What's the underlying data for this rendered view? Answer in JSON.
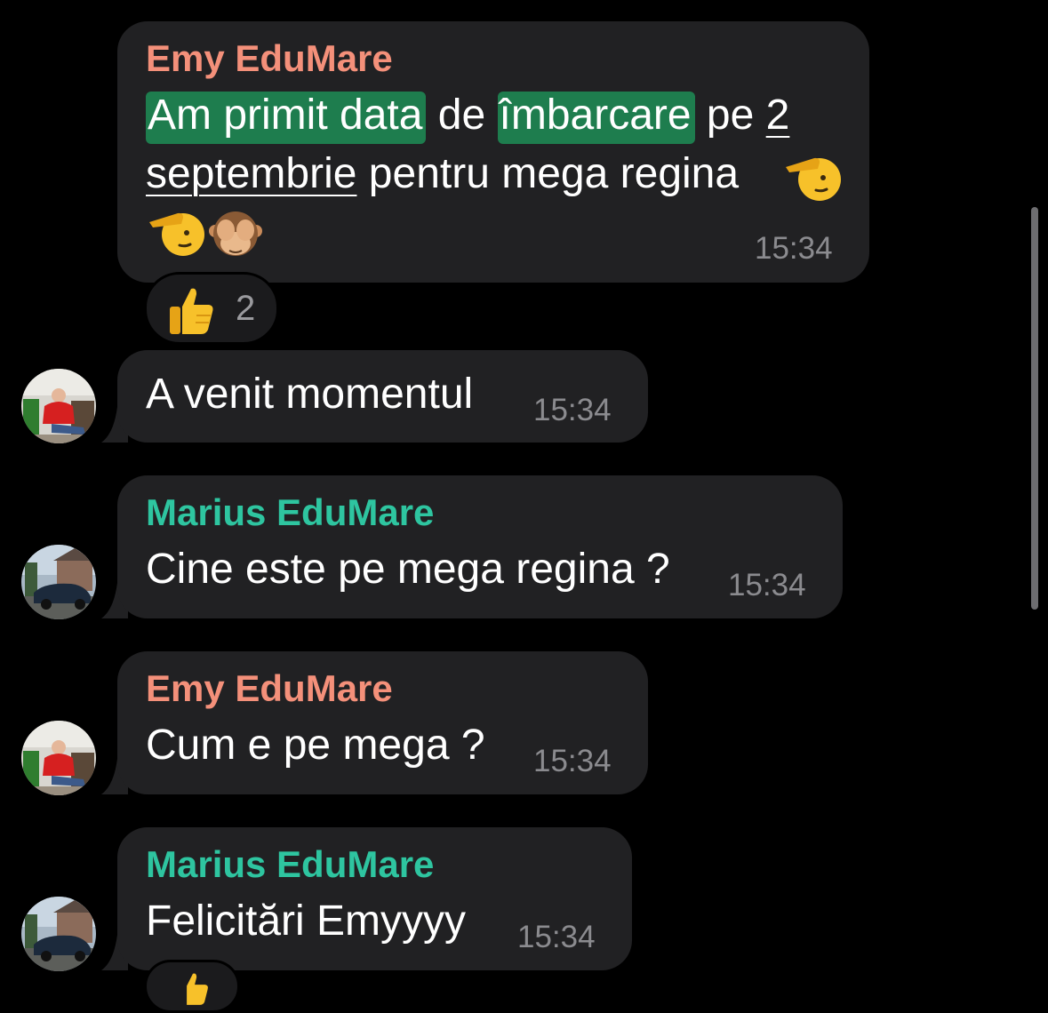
{
  "messages": [
    {
      "sender": "Emy EduMare",
      "text_parts": [
        "Am primit data",
        "de",
        "îmbarcare",
        "pe",
        "2",
        "septembrie",
        "pentru mega regina"
      ],
      "time": "15:34",
      "reaction": {
        "emoji": "thumbs-up-icon",
        "count": "2"
      }
    },
    {
      "sender": "",
      "text": "A venit momentul",
      "time": "15:34"
    },
    {
      "sender": "Marius EduMare",
      "text": "Cine este pe mega regina ?",
      "time": "15:34"
    },
    {
      "sender": "Emy EduMare",
      "text": "Cum e pe mega ?",
      "time": "15:34"
    },
    {
      "sender": "Marius EduMare",
      "text": "Felicitări Emyyyy",
      "time": "15:34"
    }
  ],
  "colors": {
    "emy_name": "#f4907a",
    "marius_name": "#2ec5a0",
    "bubble": "#212123",
    "highlight": "#1e7d4e",
    "time": "#8b8b8f"
  }
}
